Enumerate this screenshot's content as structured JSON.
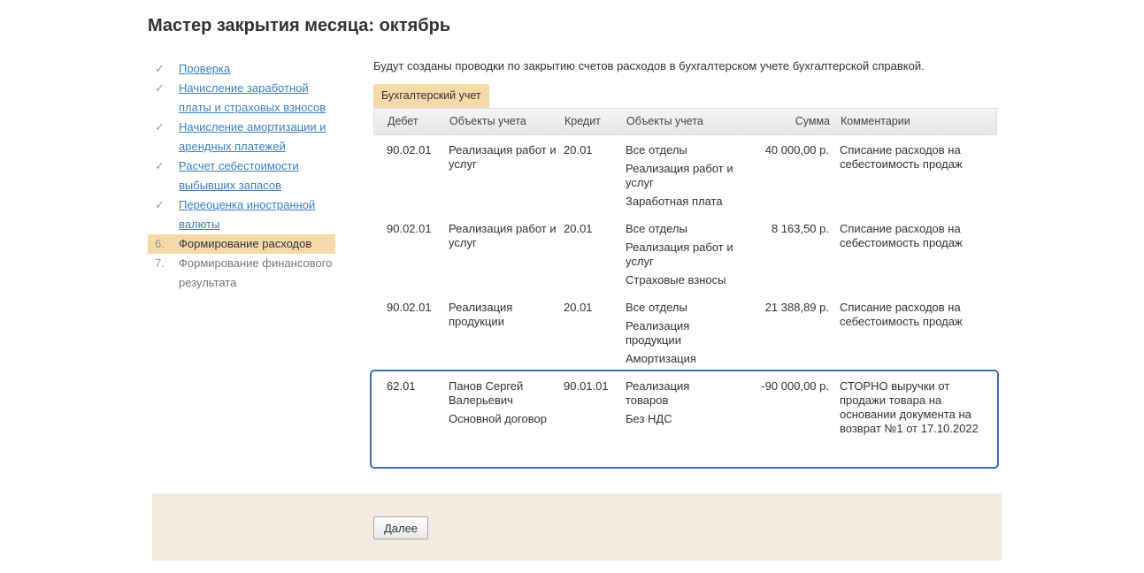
{
  "title": "Мастер закрытия месяца: октябрь",
  "steps": [
    {
      "mark": "✓",
      "label": "Проверка",
      "state": "done"
    },
    {
      "mark": "✓",
      "label": "Начисление заработной платы и страховых взносов",
      "state": "done"
    },
    {
      "mark": "✓",
      "label": "Начисление амортизации и арендных платежей",
      "state": "done"
    },
    {
      "mark": "✓",
      "label": "Расчет себестоимости выбывших запасов",
      "state": "done"
    },
    {
      "mark": "✓",
      "label": "Переоценка иностранной валюты",
      "state": "done"
    },
    {
      "mark": "6.",
      "label": "Формирование расходов",
      "state": "current"
    },
    {
      "mark": "7.",
      "label": "Формирование финансового результата",
      "state": "pending"
    }
  ],
  "intro": "Будут созданы проводки по закрытию счетов расходов в бухгалтерском учете бухгалтерской справкой.",
  "tab": "Бухгалтерский учет",
  "columns": [
    "Дебет",
    "Объекты учета",
    "Кредит",
    "Объекты учета",
    "Сумма",
    "Комментарии"
  ],
  "rows": [
    {
      "debit": "90.02.01",
      "debit_objects": [
        "Реализация работ и услуг"
      ],
      "credit": "20.01",
      "credit_objects": [
        "Все отделы",
        "Реализация работ и услуг",
        "Заработная плата"
      ],
      "sum": "40 000,00 р.",
      "comment": "Списание расходов на себестоимость продаж"
    },
    {
      "debit": "90.02.01",
      "debit_objects": [
        "Реализация работ и услуг"
      ],
      "credit": "20.01",
      "credit_objects": [
        "Все отделы",
        "Реализация работ и услуг",
        "Страховые взносы"
      ],
      "sum": "8 163,50 р.",
      "comment": "Списание расходов на себестоимость продаж"
    },
    {
      "debit": "90.02.01",
      "debit_objects": [
        "Реализация продукции"
      ],
      "credit": "20.01",
      "credit_objects": [
        "Все отделы",
        "Реализация продукции",
        "Амортизация"
      ],
      "sum": "21 388,89 р.",
      "comment": "Списание расходов на себестоимость продаж"
    },
    {
      "debit": "62.01",
      "debit_objects": [
        "Панов Сергей Валерьевич",
        "Основной договор"
      ],
      "credit": "90.01.01",
      "credit_objects": [
        "Реализация товаров",
        "Без НДС"
      ],
      "sum": "-90 000,00 р.",
      "comment": "СТОРНО выручки от продажи товара на основании документа на возврат №1 от 17.10.2022",
      "selected": true
    }
  ],
  "next_button": "Далее"
}
